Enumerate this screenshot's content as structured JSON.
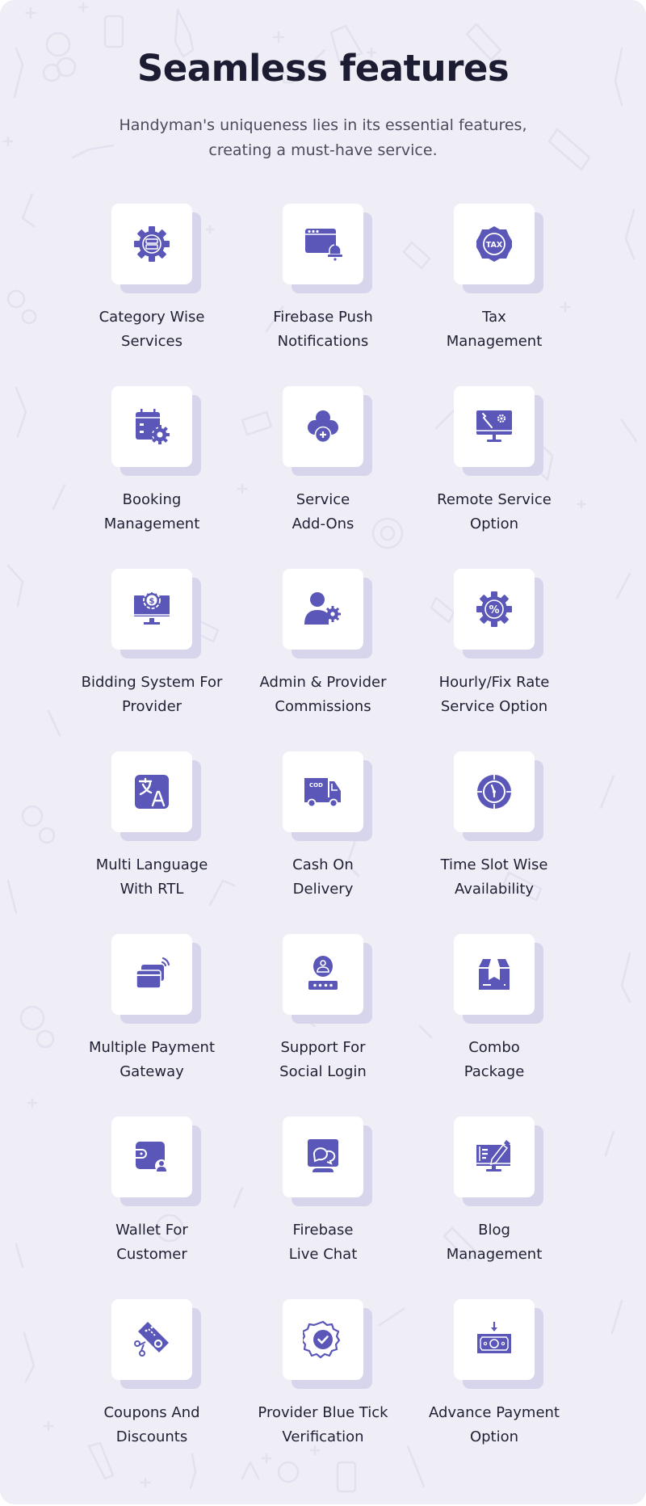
{
  "header": {
    "title": "Seamless features",
    "subtitle_line1": "Handyman's uniqueness lies in its essential features,",
    "subtitle_line2": "creating a must-have service."
  },
  "theme": {
    "icon_color": "#5a57b8",
    "card_shadow_color": "#d6d5ec",
    "background_color": "#efeef7",
    "text_color": "#1f2033"
  },
  "features": [
    {
      "icon": "gear-category-icon",
      "line1": "Category Wise",
      "line2": "Services"
    },
    {
      "icon": "browser-bell-icon",
      "line1": "Firebase Push",
      "line2": "Notifications"
    },
    {
      "icon": "tax-badge-icon",
      "line1": "Tax",
      "line2": "Management"
    },
    {
      "icon": "calendar-gear-icon",
      "line1": "Booking",
      "line2": "Management"
    },
    {
      "icon": "cloud-plus-icon",
      "line1": "Service",
      "line2": "Add-Ons"
    },
    {
      "icon": "monitor-tools-icon",
      "line1": "Remote Service",
      "line2": "Option"
    },
    {
      "icon": "monitor-dollar-icon",
      "line1": "Bidding System For",
      "line2": "Provider"
    },
    {
      "icon": "user-gear-icon",
      "line1": "Admin & Provider",
      "line2": "Commissions"
    },
    {
      "icon": "gear-percent-icon",
      "line1": "Hourly/Fix Rate",
      "line2": "Service Option"
    },
    {
      "icon": "translate-icon",
      "line1": "Multi Language",
      "line2": "With RTL"
    },
    {
      "icon": "cod-truck-icon",
      "line1": "Cash On",
      "line2": "Delivery"
    },
    {
      "icon": "clock-dial-icon",
      "line1": "Time Slot Wise",
      "line2": "Availability"
    },
    {
      "icon": "contactless-card-icon",
      "line1": "Multiple Payment",
      "line2": "Gateway"
    },
    {
      "icon": "user-login-icon",
      "line1": "Support For",
      "line2": "Social Login"
    },
    {
      "icon": "package-box-icon",
      "line1": "Combo",
      "line2": "Package"
    },
    {
      "icon": "wallet-user-icon",
      "line1": "Wallet For",
      "line2": "Customer"
    },
    {
      "icon": "monitor-chat-icon",
      "line1": "Firebase",
      "line2": "Live Chat"
    },
    {
      "icon": "monitor-edit-icon",
      "line1": "Blog",
      "line2": "Management"
    },
    {
      "icon": "coupon-scissors-icon",
      "line1": "Coupons And",
      "line2": "Discounts"
    },
    {
      "icon": "verified-badge-icon",
      "line1": "Provider Blue Tick",
      "line2": "Verification"
    },
    {
      "icon": "cash-arrow-icon",
      "line1": "Advance Payment",
      "line2": "Option"
    }
  ]
}
